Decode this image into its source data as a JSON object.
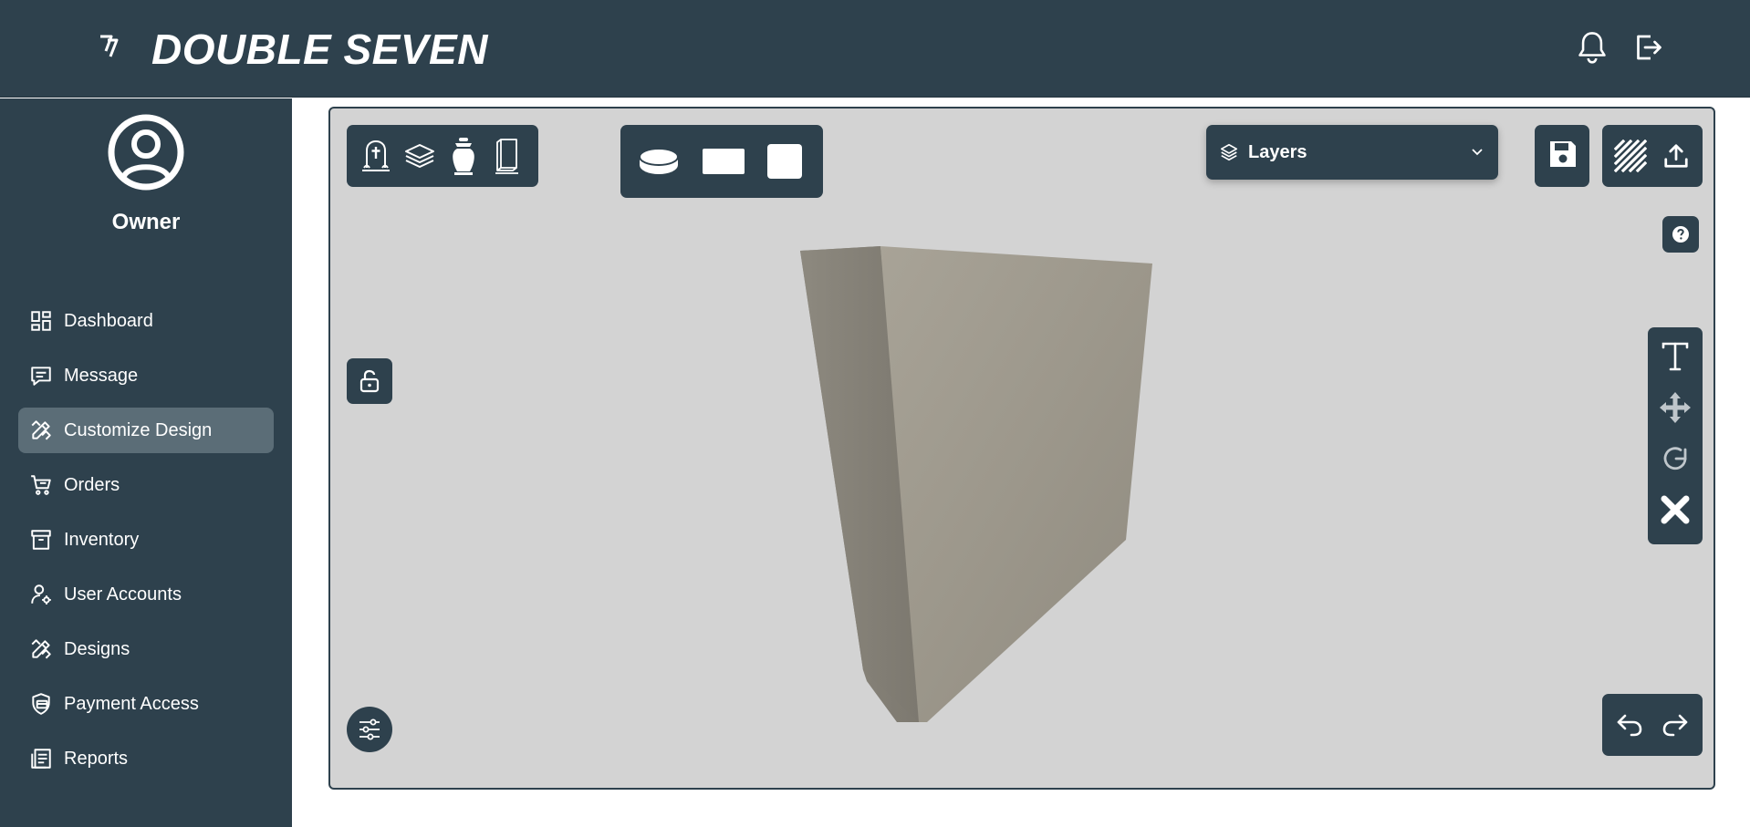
{
  "app": {
    "brand": "DOUBLE SEVEN",
    "logo_mark": "77",
    "icons": {
      "notifications": "bell-icon",
      "logout": "logout-icon"
    }
  },
  "sidebar": {
    "user_role": "Owner",
    "items": [
      {
        "label": "Dashboard",
        "icon": "dashboard-icon",
        "active": false
      },
      {
        "label": "Message",
        "icon": "message-icon",
        "active": false
      },
      {
        "label": "Customize Design",
        "icon": "customize-design-icon",
        "active": true
      },
      {
        "label": "Orders",
        "icon": "cart-icon",
        "active": false
      },
      {
        "label": "Inventory",
        "icon": "archive-icon",
        "active": false
      },
      {
        "label": "User Accounts",
        "icon": "user-settings-icon",
        "active": false
      },
      {
        "label": "Designs",
        "icon": "designs-icon",
        "active": false
      },
      {
        "label": "Payment Access",
        "icon": "shield-payment-icon",
        "active": false
      },
      {
        "label": "Reports",
        "icon": "reports-icon",
        "active": false
      }
    ]
  },
  "editor": {
    "layers_label": "Layers",
    "product_types": [
      "headstone-icon",
      "layers-stack-icon",
      "urn-icon",
      "book-plaque-icon"
    ],
    "base_shapes": [
      "cylinder-shape-icon",
      "rectangle-shape-icon",
      "square-shape-icon"
    ],
    "right_tools": [
      "text-tool-icon",
      "move-tool-icon",
      "rotate-tool-icon",
      "delete-icon"
    ],
    "history": [
      "undo-icon",
      "redo-icon"
    ],
    "colors": {
      "primary": "#2e414d",
      "active_nav": "#5b6d77",
      "canvas_bg": "#d3d3d3",
      "stone_front": "#a39e92",
      "stone_side": "#8a867c"
    }
  }
}
